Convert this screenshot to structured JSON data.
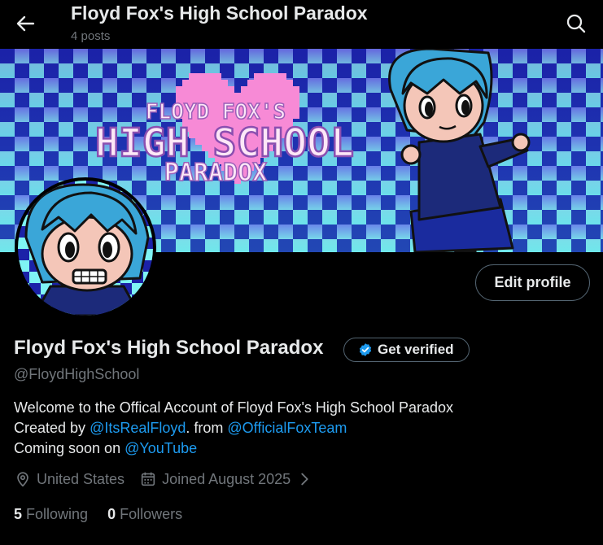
{
  "header": {
    "title": "Floyd Fox's High School Paradox",
    "post_count": "4 posts"
  },
  "banner": {
    "logo_line1": "FLOYD FOX'S",
    "logo_line2": "HIGH SCHOOL",
    "logo_line3": "PARADOX"
  },
  "profile": {
    "name": "Floyd Fox's High School Paradox",
    "handle": "@FloydHighSchool",
    "edit_label": "Edit profile",
    "verify_label": "Get verified",
    "bio": {
      "line1": "Welcome to the Offical Account of Floyd Fox's High School Paradox",
      "line2_prefix": "Created by ",
      "line2_link1": "@ItsRealFloyd",
      "line2_mid": ". from ",
      "line2_link2": "@OfficialFoxTeam",
      "line3_prefix": "Coming soon on ",
      "line3_link": "@YouTube"
    },
    "location": "United States",
    "joined": "Joined August 2025",
    "following_count": "5",
    "following_label": "Following",
    "followers_count": "0",
    "followers_label": "Followers"
  },
  "colors": {
    "accent": "#1d9bf0",
    "muted": "#71767b",
    "checker_a": "#1a1fa8",
    "checker_b": "#7ff4f4",
    "heart": "#f78ad6"
  },
  "icons": {
    "back": "arrow-left-icon",
    "search": "search-icon",
    "verified": "verified-badge-icon",
    "location": "location-pin-icon",
    "calendar": "calendar-icon",
    "chevron": "chevron-right-icon"
  }
}
